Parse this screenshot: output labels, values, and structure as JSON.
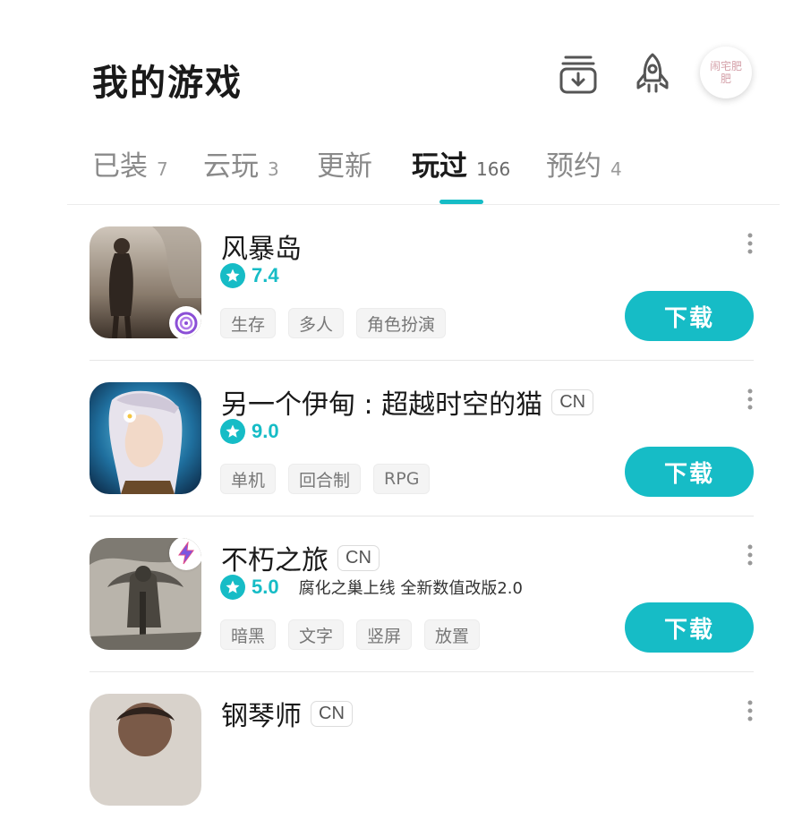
{
  "header": {
    "title": "我的游戏",
    "avatar_text": "闹宅肥肥"
  },
  "tabs": [
    {
      "label": "已装",
      "count": "7",
      "active": false
    },
    {
      "label": "云玩",
      "count": "3",
      "active": false
    },
    {
      "label": "更新",
      "count": "",
      "active": false
    },
    {
      "label": "玩过",
      "count": "166",
      "active": true
    },
    {
      "label": "预约",
      "count": "4",
      "active": false
    }
  ],
  "games": [
    {
      "name": "风暴岛",
      "region": "",
      "rating": "7.4",
      "note": "",
      "tags": [
        "生存",
        "多人",
        "角色扮演"
      ],
      "button": "下载",
      "badge_icon": "purple-spiral-icon"
    },
    {
      "name": "另一个伊甸 : 超越时空的猫",
      "region": "CN",
      "rating": "9.0",
      "note": "",
      "tags": [
        "单机",
        "回合制",
        "RPG"
      ],
      "button": "下载",
      "badge_icon": ""
    },
    {
      "name": "不朽之旅",
      "region": "CN",
      "rating": "5.0",
      "note": "腐化之巢上线 全新数值改版2.0",
      "tags": [
        "暗黑",
        "文字",
        "竖屏",
        "放置"
      ],
      "button": "下载",
      "badge_icon": "lightning-bolt-icon"
    },
    {
      "name": "钢琴师",
      "region": "CN",
      "rating": "",
      "note": "",
      "tags": [],
      "button": "",
      "badge_icon": ""
    }
  ],
  "colors": {
    "accent": "#16bcc6",
    "text": "#1a1a1a",
    "muted": "#8a8a8a"
  }
}
